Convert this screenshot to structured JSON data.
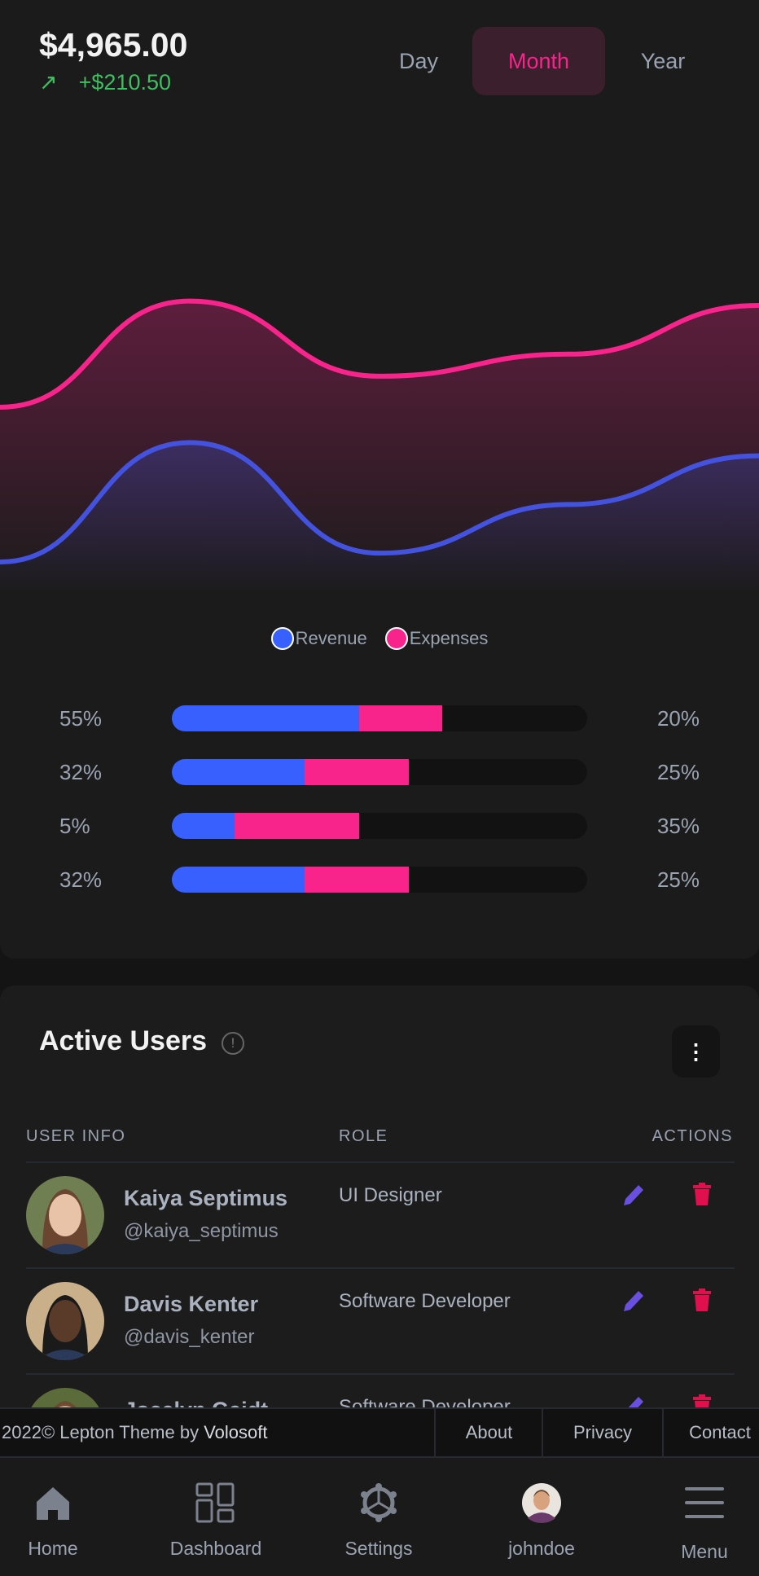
{
  "header": {
    "total": "$4,965.00",
    "delta": "+$210.50",
    "delta_icon": "arrow-up-right-icon",
    "periods": [
      "Day",
      "Month",
      "Year"
    ],
    "active_period": "Month"
  },
  "colors": {
    "revenue": "#3760ff",
    "expenses": "#f8248c",
    "positive": "#3fbf5f",
    "delete": "#e0104f",
    "edit": "#6a4fe0"
  },
  "chart_data": {
    "type": "area",
    "x": [
      0,
      1,
      2,
      3,
      4
    ],
    "ylim": [
      0,
      100
    ],
    "grid": false,
    "legend_position": "bottom",
    "series": [
      {
        "name": "Revenue",
        "values": [
          7,
          34,
          9,
          20,
          31
        ]
      },
      {
        "name": "Expenses",
        "values": [
          42,
          66,
          49,
          54,
          65
        ]
      }
    ]
  },
  "legend": {
    "revenue": "Revenue",
    "expenses": "Expenses"
  },
  "progress": [
    {
      "left": "55%",
      "right": "20%",
      "revenue_fill": 45,
      "expenses_fill": 20
    },
    {
      "left": "32%",
      "right": "25%",
      "revenue_fill": 32,
      "expenses_fill": 25
    },
    {
      "left": "5%",
      "right": "35%",
      "revenue_fill": 15,
      "expenses_fill": 30
    },
    {
      "left": "32%",
      "right": "25%",
      "revenue_fill": 32,
      "expenses_fill": 25
    }
  ],
  "users": {
    "title": "Active Users",
    "columns": [
      "USER INFO",
      "ROLE",
      "ACTIONS"
    ],
    "rows": [
      {
        "name": "Kaiya Septimus",
        "handle": "@kaiya_septimus",
        "role": "UI Designer"
      },
      {
        "name": "Davis Kenter",
        "handle": "@davis_kenter",
        "role": "Software Developer"
      },
      {
        "name": "Jocelyn Geidt",
        "handle": "",
        "role": "Software Developer"
      }
    ]
  },
  "footer": {
    "copyright": "2022© Lepton Theme by ",
    "brand": "Volosoft",
    "links": [
      "About",
      "Privacy",
      "Contact"
    ]
  },
  "nav": [
    {
      "label": "Home",
      "icon": "home-icon"
    },
    {
      "label": "Dashboard",
      "icon": "dashboard-icon"
    },
    {
      "label": "Settings",
      "icon": "gear-icon"
    },
    {
      "label": "johndoe",
      "icon": "avatar"
    },
    {
      "label": "Menu",
      "icon": "hamburger-icon"
    }
  ]
}
